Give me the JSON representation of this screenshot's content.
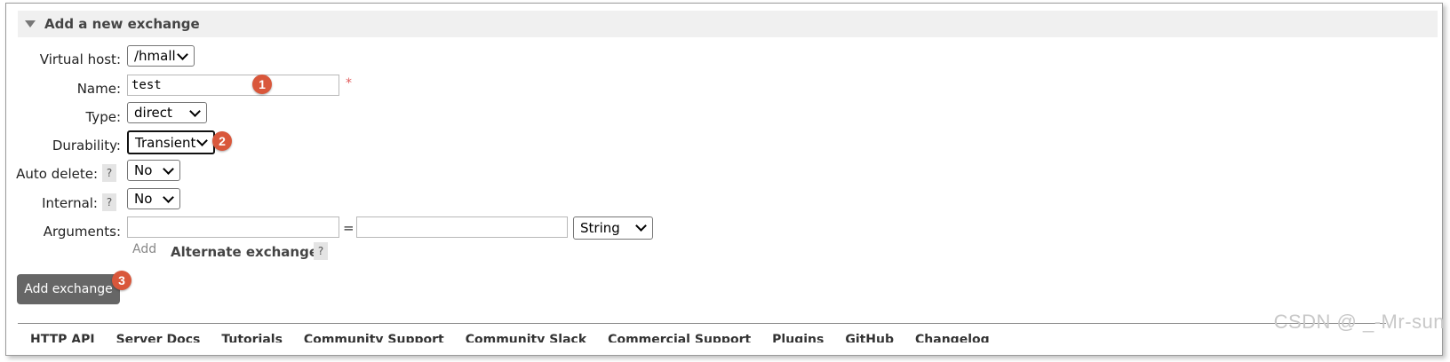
{
  "section": {
    "title": "Add a new exchange"
  },
  "form": {
    "virtual_host": {
      "label": "Virtual host:",
      "value": "/hmall"
    },
    "name": {
      "label": "Name:",
      "value": "test",
      "required_mark": "*"
    },
    "type": {
      "label": "Type:",
      "value": "direct"
    },
    "durability": {
      "label": "Durability:",
      "value": "Transient"
    },
    "auto_delete": {
      "label": "Auto delete:",
      "help": "?",
      "value": "No"
    },
    "internal": {
      "label": "Internal:",
      "help": "?",
      "value": "No"
    },
    "arguments": {
      "label": "Arguments:",
      "equals": "=",
      "type_value": "String",
      "add_label": "Add",
      "alternate_exchange": "Alternate exchange",
      "alternate_help": "?"
    }
  },
  "submit": {
    "label": "Add exchange"
  },
  "badges": [
    "1",
    "2",
    "3"
  ],
  "bottom_nav": [
    "HTTP API",
    "Server Docs",
    "Tutorials",
    "Community Support",
    "Community Slack",
    "Commercial Support",
    "Plugins",
    "GitHub",
    "Changelog"
  ],
  "watermark": "CSDN @ _-Mr-sun",
  "colors": {
    "badge": "#d9573b",
    "button": "#666666",
    "header_bg": "#f0f0f0",
    "required": "#e05a5a"
  }
}
